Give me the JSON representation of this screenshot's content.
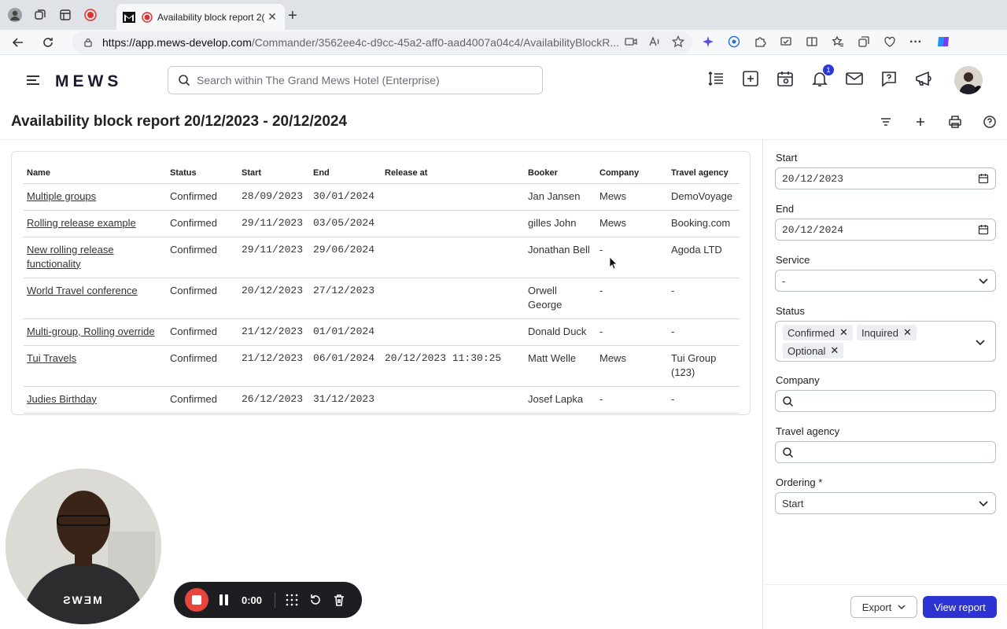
{
  "browser": {
    "tab_title": "Availability block report 2(",
    "url_host": "https://app.mews-develop.com",
    "url_path": "/Commander/3562ee4c-d9cc-45a2-aff0-aad4007a04c4/AvailabilityBlockR..."
  },
  "header": {
    "logo": "MEWS",
    "search_placeholder": "Search within The Grand Mews Hotel (Enterprise)",
    "notification_count": "1"
  },
  "page": {
    "title": "Availability block report 20/12/2023 - 20/12/2024"
  },
  "table": {
    "columns": [
      "Name",
      "Status",
      "Start",
      "End",
      "Release at",
      "Booker",
      "Company",
      "Travel agency"
    ],
    "rows": [
      {
        "name": "Multiple groups",
        "status": "Confirmed",
        "start": "28/09/2023",
        "end": "30/01/2024",
        "release": "",
        "booker": "Jan Jansen",
        "company": "Mews",
        "agency": "DemoVoyage"
      },
      {
        "name": "Rolling release example",
        "status": "Confirmed",
        "start": "29/11/2023",
        "end": "03/05/2024",
        "release": "",
        "booker": "gilles John",
        "company": "Mews",
        "agency": "Booking.com"
      },
      {
        "name": "New rolling release functionality",
        "status": "Confirmed",
        "start": "29/11/2023",
        "end": "29/06/2024",
        "release": "",
        "booker": "Jonathan Bell",
        "company": "-",
        "agency": "Agoda LTD"
      },
      {
        "name": "World Travel conference",
        "status": "Confirmed",
        "start": "20/12/2023",
        "end": "27/12/2023",
        "release": "",
        "booker": "Orwell George",
        "company": "-",
        "agency": "-"
      },
      {
        "name": "Multi-group, Rolling override",
        "status": "Confirmed",
        "start": "21/12/2023",
        "end": "01/01/2024",
        "release": "",
        "booker": "Donald Duck",
        "company": "-",
        "agency": "-"
      },
      {
        "name": "Tui Travels",
        "status": "Confirmed",
        "start": "21/12/2023",
        "end": "06/01/2024",
        "release": "20/12/2023 11:30:25",
        "booker": "Matt Welle",
        "company": "Mews",
        "agency": "Tui Group (123)"
      },
      {
        "name": "Judies Birthday",
        "status": "Confirmed",
        "start": "26/12/2023",
        "end": "31/12/2023",
        "release": "",
        "booker": "Josef Lapka",
        "company": "-",
        "agency": "-"
      }
    ]
  },
  "filters": {
    "start_label": "Start",
    "start_value": "20/12/2023",
    "end_label": "End",
    "end_value": "20/12/2024",
    "service_label": "Service",
    "service_value": "-",
    "status_label": "Status",
    "status_chips": [
      "Confirmed",
      "Inquired",
      "Optional"
    ],
    "company_label": "Company",
    "company_value": "",
    "agency_label": "Travel agency",
    "agency_value": "",
    "ordering_label": "Ordering *",
    "ordering_value": "Start"
  },
  "footer": {
    "export_label": "Export",
    "view_report_label": "View report"
  },
  "recorder": {
    "time": "0:00",
    "shirt_text": "ƧWƎM"
  },
  "colors": {
    "primary": "#2d32d2",
    "record_red": "#e8453c"
  }
}
